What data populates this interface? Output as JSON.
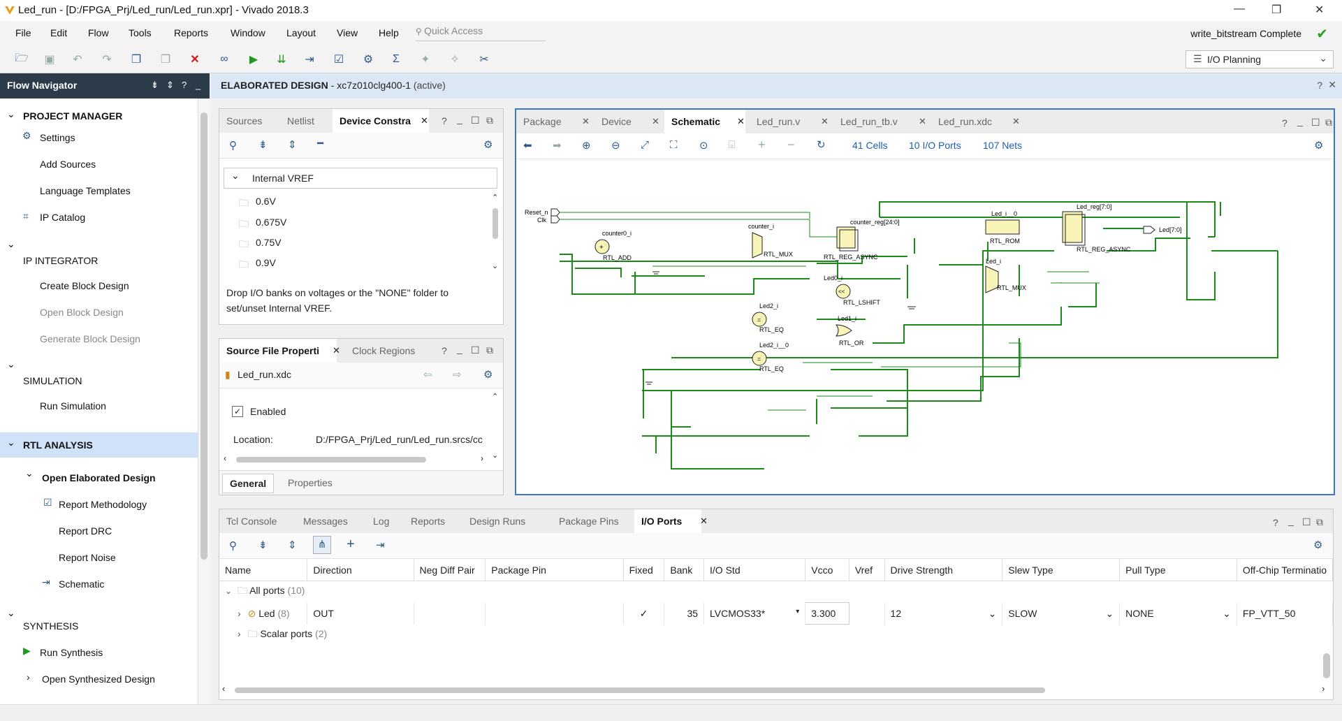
{
  "window": {
    "title": "Led_run - [D:/FPGA_Prj/Led_run/Led_run.xpr] - Vivado 2018.3",
    "minimize": "—",
    "restore": "❐",
    "close": "✕"
  },
  "menu": [
    "File",
    "Edit",
    "Flow",
    "Tools",
    "Reports",
    "Window",
    "Layout",
    "View",
    "Help"
  ],
  "quick_access": "Quick Access",
  "status": "write_bitstream Complete",
  "layout_select": "I/O Planning",
  "flow_navigator": {
    "title": "Flow Navigator",
    "sections": [
      {
        "label": "PROJECT MANAGER",
        "items": [
          "Settings",
          "Add Sources",
          "Language Templates",
          "IP Catalog"
        ]
      },
      {
        "label": "IP INTEGRATOR",
        "items": [
          "Create Block Design",
          "Open Block Design",
          "Generate Block Design"
        ]
      },
      {
        "label": "SIMULATION",
        "items": [
          "Run Simulation"
        ]
      },
      {
        "label": "RTL ANALYSIS",
        "items": [
          "Open Elaborated Design",
          "Report Methodology",
          "Report DRC",
          "Report Noise",
          "Schematic"
        ]
      },
      {
        "label": "SYNTHESIS",
        "items": [
          "Run Synthesis",
          "Open Synthesized Design"
        ]
      }
    ]
  },
  "design_header": {
    "title": "ELABORATED DESIGN",
    "part": " - xc7z010clg400-1",
    "state": " (active)"
  },
  "sources_panel": {
    "tabs": [
      "Sources",
      "Netlist",
      "Device Constra"
    ],
    "tree_root": "Internal VREF",
    "voltages": [
      "0.6V",
      "0.675V",
      "0.75V",
      "0.9V"
    ],
    "hint": "Drop I/O banks on voltages or the \"NONE\" folder to set/unset Internal VREF."
  },
  "props_panel": {
    "tabs": [
      "Source File Properti",
      "Clock Regions"
    ],
    "file": "Led_run.xdc",
    "enabled_label": "Enabled",
    "location_label": "Location:",
    "location_value": "D:/FPGA_Prj/Led_run/Led_run.srcs/cc",
    "bottom_tabs": [
      "General",
      "Properties"
    ]
  },
  "schematic_panel": {
    "tabs": [
      "Package",
      "Device",
      "Schematic",
      "Led_run.v",
      "Led_run_tb.v",
      "Led_run.xdc"
    ],
    "cells": "41 Cells",
    "ports": "10 I/O Ports",
    "nets": "107 Nets"
  },
  "schematic": {
    "ports_in": [
      "Reset_n",
      "Clk"
    ],
    "port_out": "Led[7:0]",
    "cells": [
      {
        "inst": "counter0_i",
        "type": "RTL_ADD"
      },
      {
        "inst": "counter_i",
        "type": "RTL_MUX"
      },
      {
        "inst": "counter_reg[24:0]",
        "type": "RTL_REG_ASYNC"
      },
      {
        "inst": "Led_i__0",
        "type": "RTL_ROM"
      },
      {
        "inst": "Led_reg[7:0]",
        "type": "RTL_REG_ASYNC"
      },
      {
        "inst": "Led_i",
        "type": "RTL_MUX"
      },
      {
        "inst": "Led0_i",
        "type": "RTL_LSHIFT"
      },
      {
        "inst": "Led2_i",
        "type": "RTL_EQ"
      },
      {
        "inst": "Led1_i",
        "type": "RTL_OR"
      },
      {
        "inst": "Led2_i__0",
        "type": "RTL_EQ"
      }
    ]
  },
  "bottom_panel": {
    "tabs": [
      "Tcl Console",
      "Messages",
      "Log",
      "Reports",
      "Design Runs",
      "Package Pins",
      "I/O Ports"
    ],
    "columns": [
      "Name",
      "Direction",
      "Neg Diff Pair",
      "Package Pin",
      "Fixed",
      "Bank",
      "I/O Std",
      "Vcco",
      "Vref",
      "Drive Strength",
      "Slew Type",
      "Pull Type",
      "Off-Chip Terminatio"
    ],
    "all_ports": {
      "label": "All ports",
      "count": "(10)"
    },
    "rows": [
      {
        "name": "Led",
        "count": "(8)",
        "direction": "OUT",
        "neg_diff": "",
        "pin": "",
        "fixed": "✓",
        "bank": "35",
        "iostd": "LVCMOS33*",
        "vcco": "3.300",
        "vref": "",
        "drive": "12",
        "slew": "SLOW",
        "pull": "NONE",
        "term": "FP_VTT_50"
      },
      {
        "name": "Scalar ports",
        "count": "(2)"
      }
    ]
  }
}
